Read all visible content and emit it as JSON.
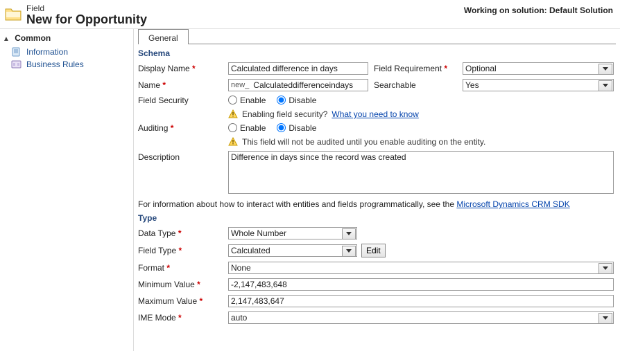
{
  "header": {
    "field_label": "Field",
    "entity_title": "New for Opportunity",
    "status_text": "Working on solution: Default Solution"
  },
  "sidebar": {
    "section_title": "Common",
    "items": [
      {
        "label": "Information"
      },
      {
        "label": "Business Rules"
      }
    ]
  },
  "tabs": {
    "general": "General"
  },
  "schema": {
    "heading": "Schema",
    "display_name_label": "Display Name",
    "display_name_value": "Calculated difference in days",
    "field_req_label": "Field Requirement",
    "field_req_value": "Optional",
    "name_label": "Name",
    "name_prefix": "new_",
    "name_value": "Calculateddifferenceindays",
    "searchable_label": "Searchable",
    "searchable_value": "Yes",
    "field_security_label": "Field Security",
    "enable_label": "Enable",
    "disable_label": "Disable",
    "fs_warn_text": "Enabling field security?",
    "fs_warn_link": "What you need to know",
    "auditing_label": "Auditing",
    "audit_warn": "This field will not be audited until you enable auditing on the entity.",
    "description_label": "Description",
    "description_value": "Difference in days since the record was created"
  },
  "info_line_pre": "For information about how to interact with entities and fields programmatically, see the ",
  "info_line_link": "Microsoft Dynamics CRM SDK",
  "type": {
    "heading": "Type",
    "data_type_label": "Data Type",
    "data_type_value": "Whole Number",
    "field_type_label": "Field Type",
    "field_type_value": "Calculated",
    "edit_btn": "Edit",
    "format_label": "Format",
    "format_value": "None",
    "min_label": "Minimum Value",
    "min_value": "-2,147,483,648",
    "max_label": "Maximum Value",
    "max_value": "2,147,483,647",
    "ime_label": "IME Mode",
    "ime_value": "auto"
  }
}
